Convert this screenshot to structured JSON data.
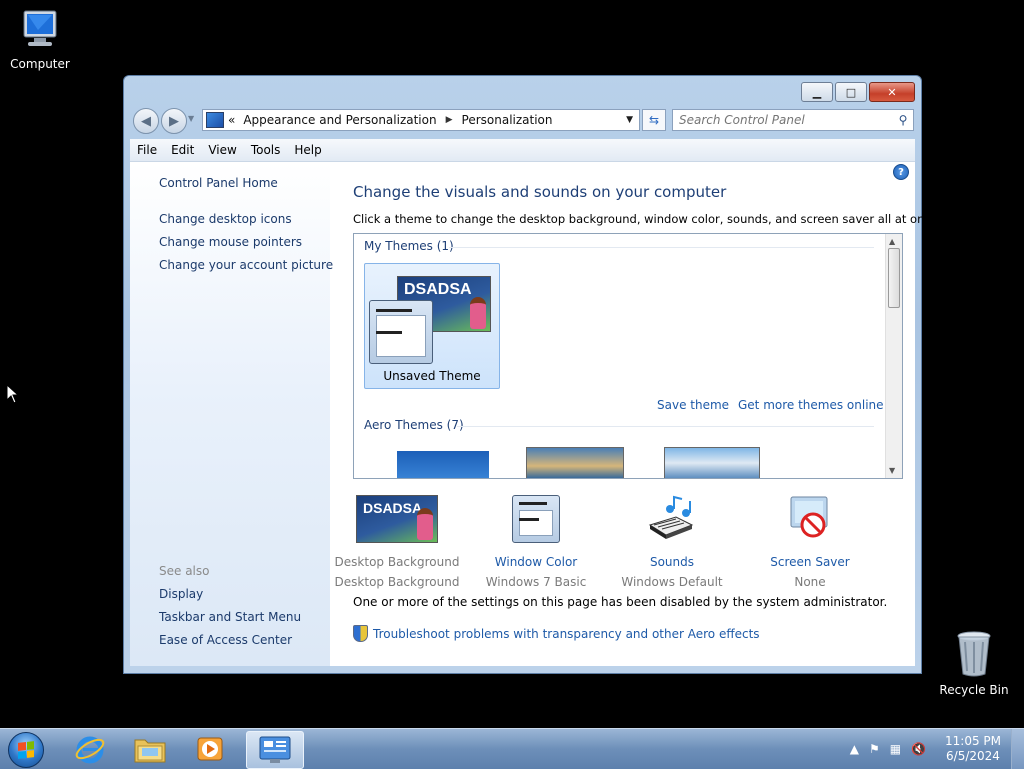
{
  "desktop": {
    "computer_label": "Computer",
    "recycle_label": "Recycle Bin"
  },
  "window": {
    "controls": {
      "minimize": "▁",
      "maximize": "□",
      "close": "✕"
    },
    "address": {
      "overflow": "«",
      "crumb1": "Appearance and Personalization",
      "sep": "▶",
      "crumb2": "Personalization"
    },
    "search": {
      "placeholder": "Search Control Panel"
    },
    "menu": [
      "File",
      "Edit",
      "View",
      "Tools",
      "Help"
    ],
    "left_pane": {
      "home": "Control Panel Home",
      "links": [
        "Change desktop icons",
        "Change mouse pointers",
        "Change your account picture"
      ],
      "see_also_title": "See also",
      "see_also": [
        "Display",
        "Taskbar and Start Menu",
        "Ease of Access Center"
      ]
    },
    "main": {
      "heading": "Change the visuals and sounds on your computer",
      "description": "Click a theme to change the desktop background, window color, sounds, and screen saver all at once.",
      "my_themes": "My Themes (1)",
      "unsaved_theme": "Unsaved Theme",
      "thumb_brand": "DSADSA",
      "save_theme": "Save theme",
      "more_themes": "Get more themes online",
      "aero_themes": "Aero Themes (7)",
      "settings": [
        {
          "name": "Desktop Background",
          "value": "Desktop Background",
          "enabled": false,
          "icon": "desktop-background-icon"
        },
        {
          "name": "Window Color",
          "value": "Windows 7 Basic",
          "enabled": true,
          "icon": "window-color-icon"
        },
        {
          "name": "Sounds",
          "value": "Windows Default",
          "enabled": true,
          "icon": "sounds-icon"
        },
        {
          "name": "Screen Saver",
          "value": "None",
          "enabled": true,
          "icon": "screen-saver-icon"
        }
      ],
      "disabled_msg": "One or more of the settings on this page has been disabled by the system administrator.",
      "troubleshoot": "Troubleshoot problems with transparency and other Aero effects"
    }
  },
  "taskbar": {
    "time": "11:05 PM",
    "date": "6/5/2024",
    "apps": [
      "internet-explorer-icon",
      "file-explorer-icon",
      "media-player-icon",
      "control-panel-icon"
    ]
  }
}
